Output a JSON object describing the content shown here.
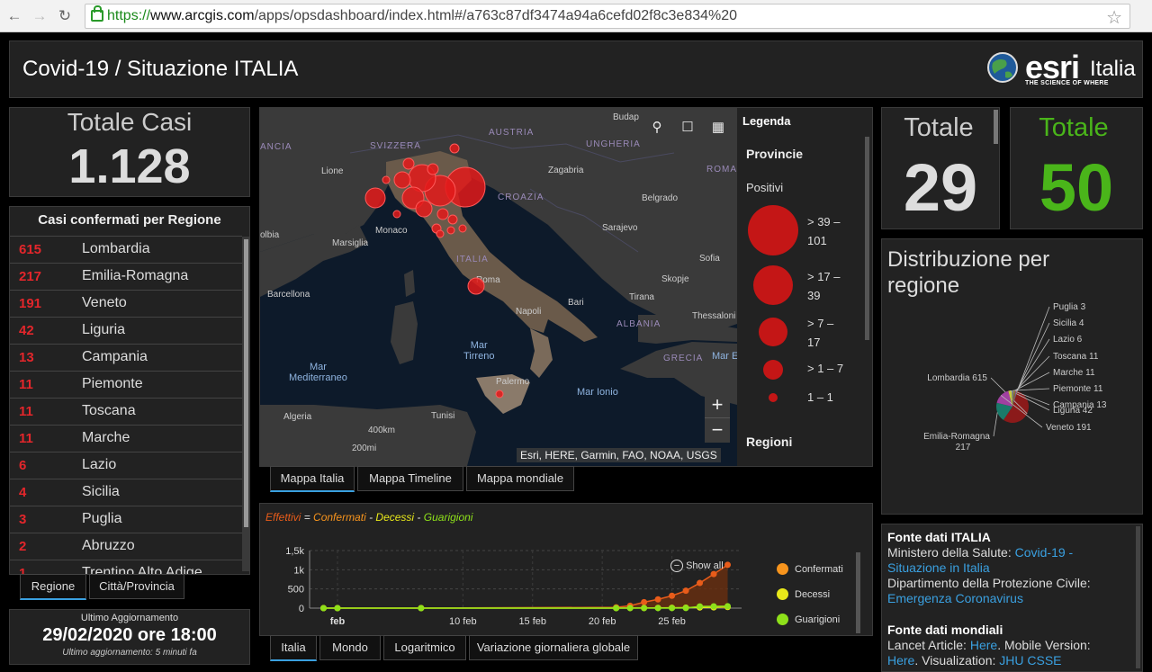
{
  "browser": {
    "url_protocol": "https://",
    "url_host": "www.arcgis.com",
    "url_path": "/apps/opsdashboard/index.html#/a763c87df3474a94a6cefd02f8c3e834%20"
  },
  "header": {
    "title": "Covid-19 / Situazione ITALIA",
    "logo_word": "esri",
    "logo_country": "Italia",
    "logo_tagline": "THE SCIENCE OF WHERE"
  },
  "totale_casi": {
    "label": "Totale Casi",
    "value": "1.128"
  },
  "regions": {
    "title": "Casi confermati per Regione",
    "items": [
      {
        "count": "615",
        "name": "Lombardia"
      },
      {
        "count": "217",
        "name": "Emilia-Romagna"
      },
      {
        "count": "191",
        "name": "Veneto"
      },
      {
        "count": "42",
        "name": "Liguria"
      },
      {
        "count": "13",
        "name": "Campania"
      },
      {
        "count": "11",
        "name": "Piemonte"
      },
      {
        "count": "11",
        "name": "Toscana"
      },
      {
        "count": "11",
        "name": "Marche"
      },
      {
        "count": "6",
        "name": "Lazio"
      },
      {
        "count": "4",
        "name": "Sicilia"
      },
      {
        "count": "3",
        "name": "Puglia"
      },
      {
        "count": "2",
        "name": "Abruzzo"
      },
      {
        "count": "1",
        "name": "Trentino Alto Adige"
      }
    ]
  },
  "list_tabs": [
    "Regione",
    "Città/Provincia"
  ],
  "update": {
    "label": "Ultimo Aggiornamento",
    "value": "29/02/2020 ore 18:00",
    "note": "Ultimo aggiornamento: 5 minuti fa"
  },
  "map": {
    "labels": {
      "austria": "AUSTRIA",
      "svizzera": "SVIZZERA",
      "ungheria": "UNGHERIA",
      "croazia": "CROAZIA",
      "roma_country": "ROMA",
      "italia": "ITALIA",
      "albania": "ALBANIA",
      "grecia": "GRECIA",
      "francia": "ANCIA",
      "budapest": "Budap",
      "lione": "Lione",
      "zagabria": "Zagabria",
      "belgrado": "Belgrado",
      "sarajevo": "Sarajevo",
      "sofia": "Sofia",
      "marsiglia": "Marsiglia",
      "monaco": "Monaco",
      "barcellona": "Barcellona",
      "skopje": "Skopje",
      "tirana": "Tirana",
      "bari": "Bari",
      "napoli": "Napoli",
      "roma": "Roma",
      "thessaloniki": "Thessaloni",
      "palermo": "Palermo",
      "algeria": "Algeria",
      "tunisi": "Tunisi",
      "mar_med": "Mar\nMediterraneo",
      "mar_tirreno": "Mar\nTirreno",
      "mar_ionio": "Mar Ionio",
      "mar_eg": "Mar E",
      "olbia": "olbia",
      "scale_km": "400km",
      "scale_mi": "200mi"
    },
    "attribution": "Esri, HERE, Garmin, FAO, NOAA, USGS",
    "zoom_in": "+",
    "zoom_out": "−"
  },
  "legend": {
    "title": "Legenda",
    "layer": "Provincie",
    "field": "Positivi",
    "classes": [
      "> 39 –\n101",
      "> 17 –\n39",
      "> 7 –\n17",
      "> 1 – 7",
      "1 – 1"
    ],
    "layer2": "Regioni",
    "color": "#c41616"
  },
  "map_tabs": [
    "Mappa Italia",
    "Mappa Timeline",
    "Mappa mondiale"
  ],
  "chart_tabs": [
    "Italia",
    "Mondo",
    "Logaritmico",
    "Variazione giornaliera globale"
  ],
  "chart_title": {
    "effettivi": "Effettivi",
    "eq": " = ",
    "confermati": "Confermati",
    "sep1": " - ",
    "decessi": "Decessi",
    "sep2": " - ",
    "guarigioni": "Guarigioni"
  },
  "chart_show_all": "Show all",
  "colors": {
    "confermati": "#f7941d",
    "decessi": "#e8e81a",
    "guarigioni": "#8ee01a",
    "effettivi": "#e85c1a",
    "accent": "#3aa0e0",
    "red": "#e3262b"
  },
  "chart_data": {
    "type": "line",
    "x": [
      "2020-01-31",
      "2020-02-01",
      "2020-02-07",
      "2020-02-21",
      "2020-02-22",
      "2020-02-23",
      "2020-02-24",
      "2020-02-25",
      "2020-02-26",
      "2020-02-27",
      "2020-02-28",
      "2020-02-29"
    ],
    "series": [
      {
        "name": "Confermati",
        "color": "#f7941d",
        "values": [
          2,
          2,
          3,
          20,
          62,
          155,
          229,
          322,
          453,
          655,
          888,
          1128
        ]
      },
      {
        "name": "Decessi",
        "color": "#e8e81a",
        "values": [
          0,
          0,
          0,
          1,
          2,
          3,
          7,
          10,
          12,
          17,
          21,
          29
        ]
      },
      {
        "name": "Guarigioni",
        "color": "#8ee01a",
        "values": [
          0,
          0,
          0,
          0,
          1,
          2,
          1,
          1,
          3,
          45,
          46,
          50
        ]
      }
    ],
    "x_ticks": [
      "feb",
      "10 feb",
      "15 feb",
      "20 feb",
      "25 feb"
    ],
    "y_ticks": [
      "0",
      "500",
      "1k",
      "1,5k"
    ],
    "ylim": [
      0,
      1500
    ]
  },
  "totals": {
    "deaths": {
      "label": "Totale",
      "value": "29"
    },
    "recovered": {
      "label": "Totale",
      "value": "50"
    }
  },
  "distribution": {
    "title": "Distribuzione per\nregione",
    "slices": [
      {
        "label": "Lombardia 615",
        "value": 615,
        "color": "#8b1a1a"
      },
      {
        "label": "Emilia-Romagna\n217",
        "value": 217,
        "color": "#1a7a6a"
      },
      {
        "label": "Veneto 191",
        "value": 191,
        "color": "#a040a0"
      },
      {
        "label": "Liguria 42",
        "value": 42,
        "color": "#c8c83a"
      },
      {
        "label": "Campania 13",
        "value": 13,
        "color": "#3a6ac8"
      },
      {
        "label": "Piemonte 11",
        "value": 11,
        "color": "#e07020"
      },
      {
        "label": "Marche 11",
        "value": 11,
        "color": "#40a040"
      },
      {
        "label": "Toscana 11",
        "value": 11,
        "color": "#c04040"
      },
      {
        "label": "Lazio 6",
        "value": 6,
        "color": "#8040c0"
      },
      {
        "label": "Sicilia 4",
        "value": 4,
        "color": "#40c0c0"
      },
      {
        "label": "Puglia 3",
        "value": 3,
        "color": "#c0a040"
      }
    ]
  },
  "sources": {
    "it_title": "Fonte dati ITALIA",
    "it_line1_pre": "Ministero della Salute: ",
    "it_line1_link": "Covid-19 -",
    "it_line2_link": "Situazione in Italia",
    "it_line3": "Dipartimento della Protezione Civile:",
    "it_line4_link": "Emergenza Coronavirus",
    "world_title": "Fonte dati mondiali",
    "world_line1_pre": "Lancet Article: ",
    "world_line1_link": "Here",
    "world_line1_post": ". Mobile Version:",
    "world_line2_link": "Here",
    "world_line2_mid": ". Visualization: ",
    "world_line2_link2": "JHU CSSE"
  }
}
